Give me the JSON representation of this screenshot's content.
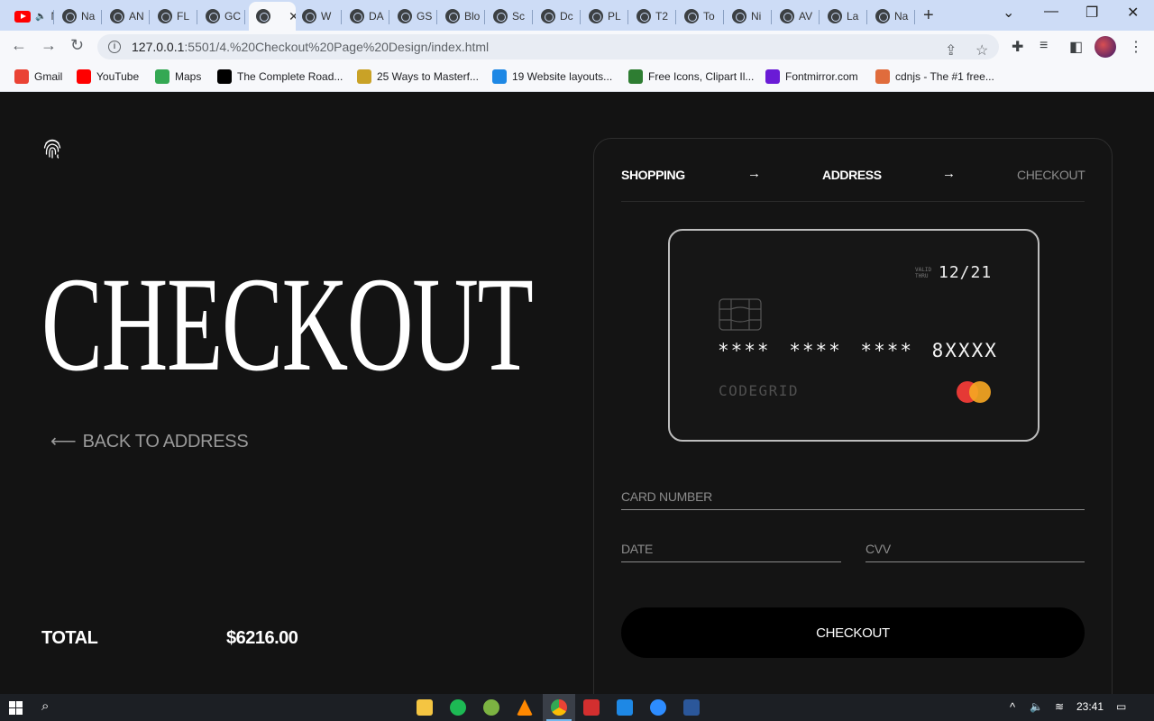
{
  "browser": {
    "tabs": [
      {
        "label": "Na",
        "icon": "youtube-icon",
        "muted": true
      },
      {
        "label": "Na"
      },
      {
        "label": "AN"
      },
      {
        "label": "FL"
      },
      {
        "label": "GC"
      },
      {
        "label": "",
        "active": true
      },
      {
        "label": "W"
      },
      {
        "label": "DA"
      },
      {
        "label": "GS"
      },
      {
        "label": "Blo"
      },
      {
        "label": "Sc"
      },
      {
        "label": "Dc"
      },
      {
        "label": "PL"
      },
      {
        "label": "T2"
      },
      {
        "label": "To"
      },
      {
        "label": "Ni"
      },
      {
        "label": "AV"
      },
      {
        "label": "La"
      },
      {
        "label": "Na"
      }
    ],
    "url_host": "127.0.0.1",
    "url_path": ":5501/4.%20Checkout%20Page%20Design/index.html",
    "bookmarks": [
      {
        "label": "Gmail",
        "color": "#ea4335"
      },
      {
        "label": "YouTube",
        "color": "#ff0000"
      },
      {
        "label": "Maps",
        "color": "#34a853"
      },
      {
        "label": "The Complete Road...",
        "color": "#000000"
      },
      {
        "label": "25 Ways to Masterf...",
        "color": "#c9a227"
      },
      {
        "label": "19 Website layouts...",
        "color": "#1e88e5"
      },
      {
        "label": "Free Icons, Clipart Il...",
        "color": "#2e7d32"
      },
      {
        "label": "Fontmirror.com",
        "color": "#6a1bd6"
      },
      {
        "label": "cdnjs - The #1 free...",
        "color": "#e06c3c"
      }
    ]
  },
  "left": {
    "logo_icon": "fingerprint-icon",
    "title": "CHECKOUT",
    "back_arrow": "⟵",
    "back_label": "BACK TO ADDRESS",
    "total_label": "TOTAL",
    "total_value": "$6216.00"
  },
  "steps": {
    "shopping": "SHOPPING",
    "address": "ADDRESS",
    "checkout": "CHECKOUT",
    "arrow": "→"
  },
  "card": {
    "valid_line1": "VALID",
    "valid_line2": "THRU",
    "expiry": "12/21",
    "number": "**** **** **** 8XXXX",
    "brand": "CODEGRID",
    "network_icon": "mastercard-icon"
  },
  "form": {
    "card_number_placeholder": "CARD NUMBER",
    "date_placeholder": "DATE",
    "cvv_placeholder": "CVV",
    "submit_label": "CHECKOUT"
  },
  "taskbar": {
    "time": "23:41"
  },
  "colors": {
    "page_bg": "#131313",
    "accent_red": "#e53935",
    "accent_orange": "#f5a623"
  }
}
